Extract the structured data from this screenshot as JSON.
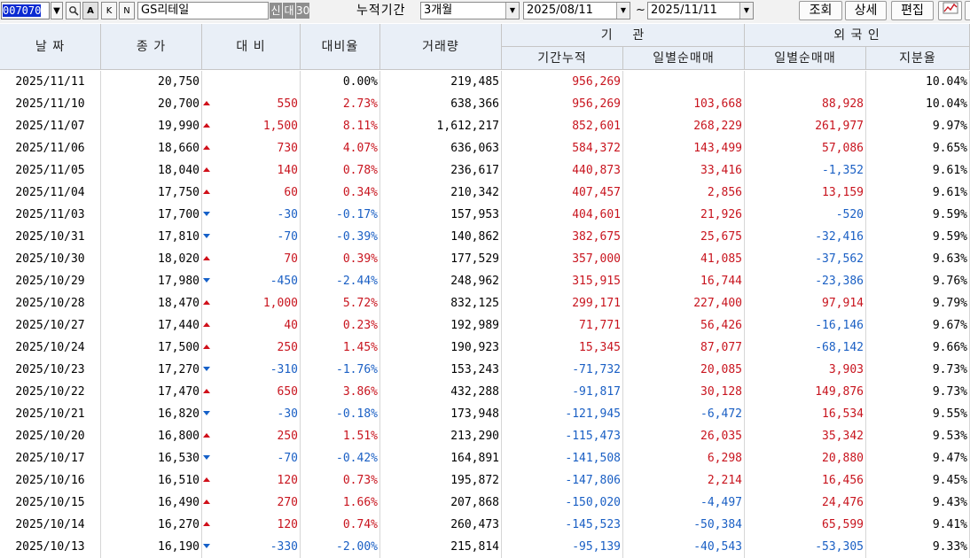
{
  "toolbar": {
    "code": "007070",
    "btn_a": "A",
    "btn_k": "K",
    "btn_n": "N",
    "stock_name": "GS리테일",
    "badge_credit": "신",
    "badge_loan": "대",
    "badge_30": "30",
    "period_label": "누적기간",
    "period_value": "3개월",
    "start_date": "2025/08/11",
    "tilde": "~",
    "end_date": "2025/11/11",
    "query_btn": "조회",
    "detail_btn": "상세",
    "edit_btn": "편집"
  },
  "header": {
    "date": "날 짜",
    "close": "종 가",
    "change": "대 비",
    "change_rate": "대비율",
    "volume": "거래량",
    "institution": "기    관",
    "foreign": "외 국 인",
    "inst_cum": "기간누적",
    "inst_daily": "일별순매매",
    "for_daily": "일별순매매",
    "for_ratio": "지분율"
  },
  "colors": {
    "up": "#c8141e",
    "down": "#1a5fc4",
    "header_bg": "#e9eff7"
  },
  "rows": [
    {
      "date": "2025/11/11",
      "close": "20,750",
      "dir": "",
      "change": "",
      "rate": "0.00%",
      "volume": "219,485",
      "inst_cum": "956,269",
      "inst_daily": "",
      "for_daily": "",
      "ratio": "10.04%"
    },
    {
      "date": "2025/11/10",
      "close": "20,700",
      "dir": "up",
      "change": "550",
      "rate": "2.73%",
      "volume": "638,366",
      "inst_cum": "956,269",
      "inst_daily": "103,668",
      "for_daily": "88,928",
      "ratio": "10.04%"
    },
    {
      "date": "2025/11/07",
      "close": "19,990",
      "dir": "up",
      "change": "1,500",
      "rate": "8.11%",
      "volume": "1,612,217",
      "inst_cum": "852,601",
      "inst_daily": "268,229",
      "for_daily": "261,977",
      "ratio": "9.97%"
    },
    {
      "date": "2025/11/06",
      "close": "18,660",
      "dir": "up",
      "change": "730",
      "rate": "4.07%",
      "volume": "636,063",
      "inst_cum": "584,372",
      "inst_daily": "143,499",
      "for_daily": "57,086",
      "ratio": "9.65%"
    },
    {
      "date": "2025/11/05",
      "close": "18,040",
      "dir": "up",
      "change": "140",
      "rate": "0.78%",
      "volume": "236,617",
      "inst_cum": "440,873",
      "inst_daily": "33,416",
      "for_daily": "-1,352",
      "ratio": "9.61%"
    },
    {
      "date": "2025/11/04",
      "close": "17,750",
      "dir": "up",
      "change": "60",
      "rate": "0.34%",
      "volume": "210,342",
      "inst_cum": "407,457",
      "inst_daily": "2,856",
      "for_daily": "13,159",
      "ratio": "9.61%"
    },
    {
      "date": "2025/11/03",
      "close": "17,700",
      "dir": "down",
      "change": "-30",
      "rate": "-0.17%",
      "volume": "157,953",
      "inst_cum": "404,601",
      "inst_daily": "21,926",
      "for_daily": "-520",
      "ratio": "9.59%"
    },
    {
      "date": "2025/10/31",
      "close": "17,810",
      "dir": "down",
      "change": "-70",
      "rate": "-0.39%",
      "volume": "140,862",
      "inst_cum": "382,675",
      "inst_daily": "25,675",
      "for_daily": "-32,416",
      "ratio": "9.59%"
    },
    {
      "date": "2025/10/30",
      "close": "18,020",
      "dir": "up",
      "change": "70",
      "rate": "0.39%",
      "volume": "177,529",
      "inst_cum": "357,000",
      "inst_daily": "41,085",
      "for_daily": "-37,562",
      "ratio": "9.63%"
    },
    {
      "date": "2025/10/29",
      "close": "17,980",
      "dir": "down",
      "change": "-450",
      "rate": "-2.44%",
      "volume": "248,962",
      "inst_cum": "315,915",
      "inst_daily": "16,744",
      "for_daily": "-23,386",
      "ratio": "9.76%"
    },
    {
      "date": "2025/10/28",
      "close": "18,470",
      "dir": "up",
      "change": "1,000",
      "rate": "5.72%",
      "volume": "832,125",
      "inst_cum": "299,171",
      "inst_daily": "227,400",
      "for_daily": "97,914",
      "ratio": "9.79%"
    },
    {
      "date": "2025/10/27",
      "close": "17,440",
      "dir": "up",
      "change": "40",
      "rate": "0.23%",
      "volume": "192,989",
      "inst_cum": "71,771",
      "inst_daily": "56,426",
      "for_daily": "-16,146",
      "ratio": "9.67%"
    },
    {
      "date": "2025/10/24",
      "close": "17,500",
      "dir": "up",
      "change": "250",
      "rate": "1.45%",
      "volume": "190,923",
      "inst_cum": "15,345",
      "inst_daily": "87,077",
      "for_daily": "-68,142",
      "ratio": "9.66%"
    },
    {
      "date": "2025/10/23",
      "close": "17,270",
      "dir": "down",
      "change": "-310",
      "rate": "-1.76%",
      "volume": "153,243",
      "inst_cum": "-71,732",
      "inst_daily": "20,085",
      "for_daily": "3,903",
      "ratio": "9.73%"
    },
    {
      "date": "2025/10/22",
      "close": "17,470",
      "dir": "up",
      "change": "650",
      "rate": "3.86%",
      "volume": "432,288",
      "inst_cum": "-91,817",
      "inst_daily": "30,128",
      "for_daily": "149,876",
      "ratio": "9.73%"
    },
    {
      "date": "2025/10/21",
      "close": "16,820",
      "dir": "down",
      "change": "-30",
      "rate": "-0.18%",
      "volume": "173,948",
      "inst_cum": "-121,945",
      "inst_daily": "-6,472",
      "for_daily": "16,534",
      "ratio": "9.55%"
    },
    {
      "date": "2025/10/20",
      "close": "16,800",
      "dir": "up",
      "change": "250",
      "rate": "1.51%",
      "volume": "213,290",
      "inst_cum": "-115,473",
      "inst_daily": "26,035",
      "for_daily": "35,342",
      "ratio": "9.53%"
    },
    {
      "date": "2025/10/17",
      "close": "16,530",
      "dir": "down",
      "change": "-70",
      "rate": "-0.42%",
      "volume": "164,891",
      "inst_cum": "-141,508",
      "inst_daily": "6,298",
      "for_daily": "20,880",
      "ratio": "9.47%"
    },
    {
      "date": "2025/10/16",
      "close": "16,510",
      "dir": "up",
      "change": "120",
      "rate": "0.73%",
      "volume": "195,872",
      "inst_cum": "-147,806",
      "inst_daily": "2,214",
      "for_daily": "16,456",
      "ratio": "9.45%"
    },
    {
      "date": "2025/10/15",
      "close": "16,490",
      "dir": "up",
      "change": "270",
      "rate": "1.66%",
      "volume": "207,868",
      "inst_cum": "-150,020",
      "inst_daily": "-4,497",
      "for_daily": "24,476",
      "ratio": "9.43%"
    },
    {
      "date": "2025/10/14",
      "close": "16,270",
      "dir": "up",
      "change": "120",
      "rate": "0.74%",
      "volume": "260,473",
      "inst_cum": "-145,523",
      "inst_daily": "-50,384",
      "for_daily": "65,599",
      "ratio": "9.41%"
    },
    {
      "date": "2025/10/13",
      "close": "16,190",
      "dir": "down",
      "change": "-330",
      "rate": "-2.00%",
      "volume": "215,814",
      "inst_cum": "-95,139",
      "inst_daily": "-40,543",
      "for_daily": "-53,305",
      "ratio": "9.33%"
    }
  ]
}
